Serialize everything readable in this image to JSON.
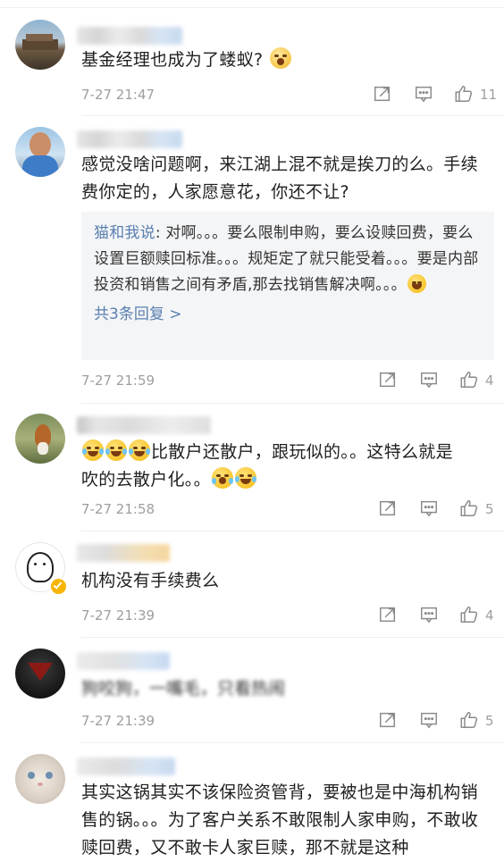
{
  "comments": [
    {
      "text": "基金经理也成为了蝼蚁? ",
      "time": "7-27 21:47",
      "likes": "11"
    },
    {
      "text": "感觉没啥问题啊，来江湖上混不就是挨刀的么。手续费你定的，人家愿意花，你还不让?",
      "time": "7-27 21:59",
      "likes": "4",
      "reply": {
        "author": "猫和我说",
        "colon": ": ",
        "text": "对啊。。。要么限制申购，要么设赎回费，要么设置巨额赎回标准。。。规矩定了就只能受着。。。要是内部投资和销售之间有矛盾,那去找销售解决啊。。。",
        "more": "共3条回复 >"
      }
    },
    {
      "text_line1": "比散户还散户，跟玩似的。。这特么就是",
      "text_line2": "吹的去散户化。。",
      "time": "7-27 21:58",
      "likes": "5"
    },
    {
      "text": "机构没有手续费么",
      "time": "7-27 21:39",
      "likes": "4"
    },
    {
      "text": "狗咬狗，一嘴毛，只看热闹",
      "time": "7-27 21:39",
      "likes": "5"
    },
    {
      "text": "其实这锅其实不该保险资管背，要被也是中海机构销售的锅。。。为了客户关系不敢限制人家申购，不敢收赎回费，又不敢卡人家巨赎，那不就是这种"
    }
  ],
  "icons": {
    "share": "share-icon",
    "comment": "comment-icon",
    "like": "thumbs-up-icon",
    "emoji": "emoji-icon"
  },
  "colors": {
    "link": "#5a7fb0",
    "meta": "#9e9e9e",
    "reply_bg": "#f4f5f7"
  }
}
